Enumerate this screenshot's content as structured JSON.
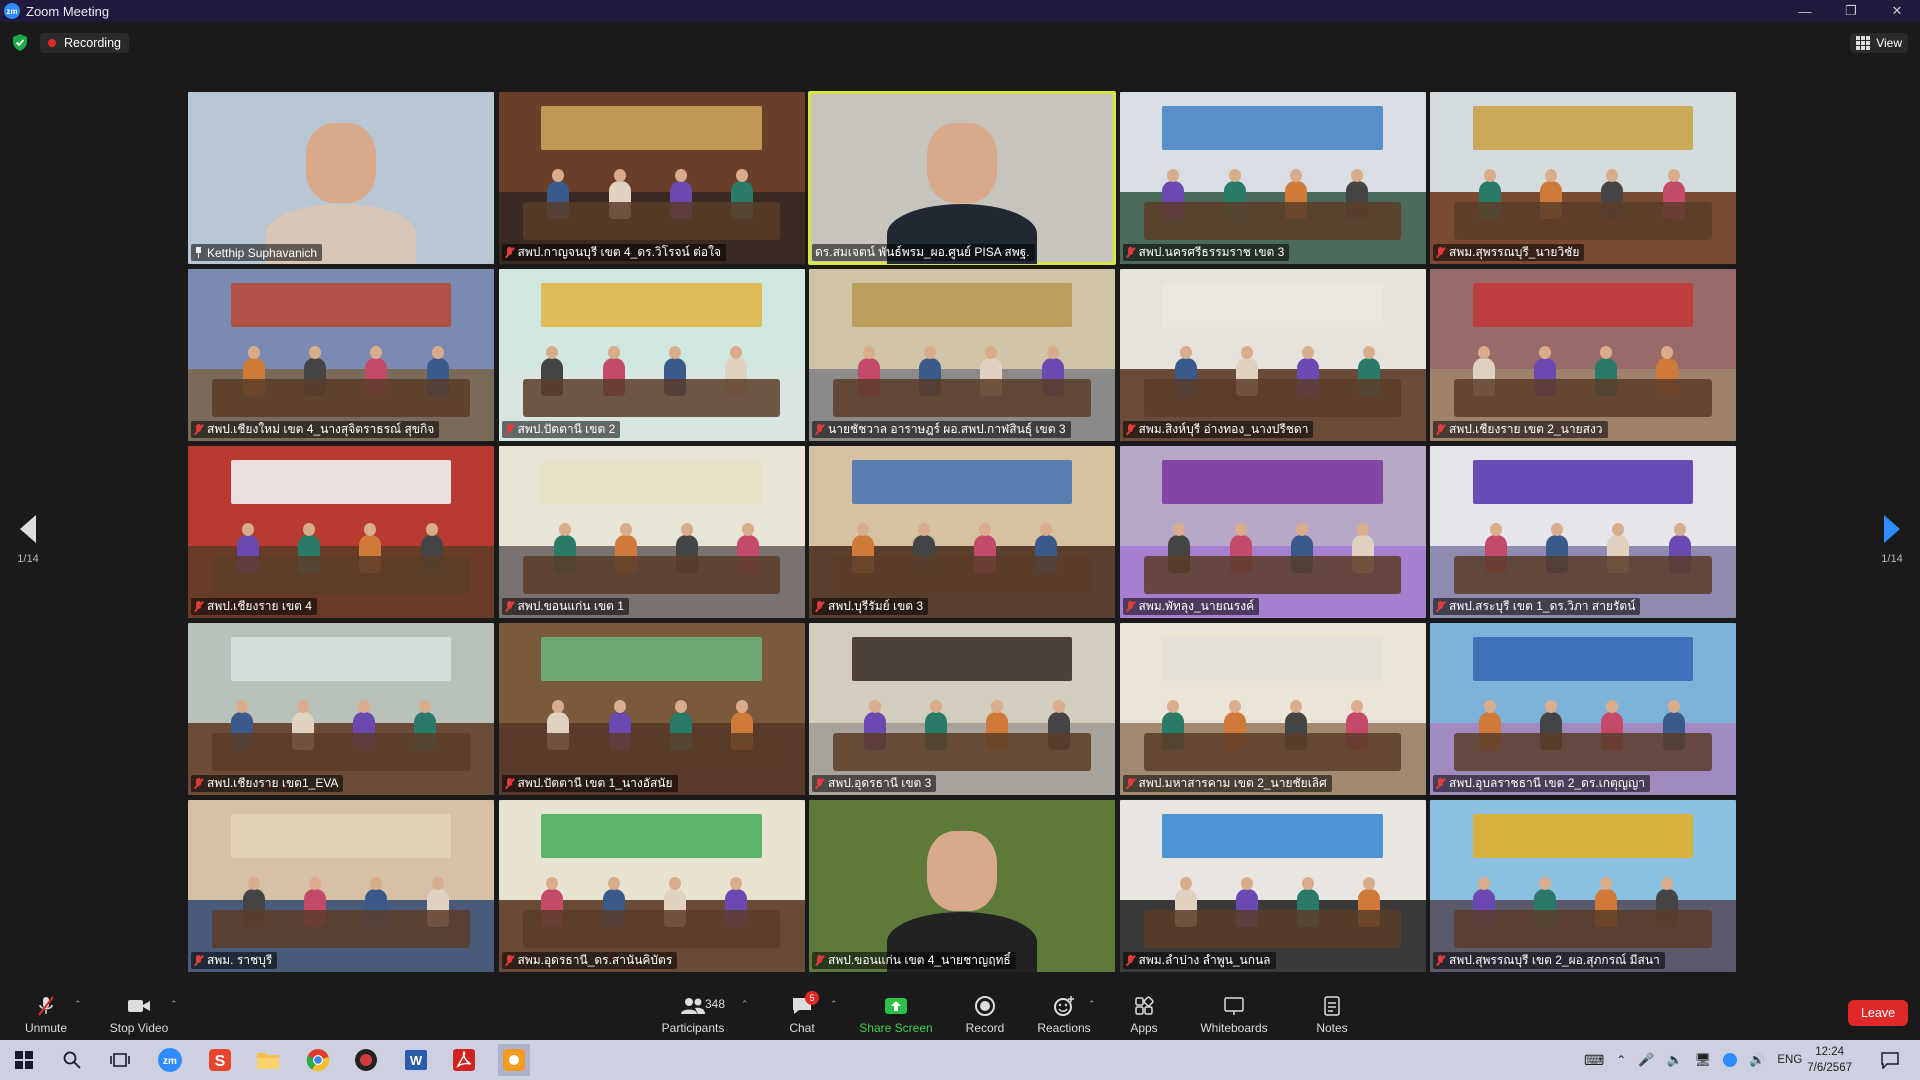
{
  "window": {
    "title": "Zoom Meeting",
    "app_icon": "zm"
  },
  "topbar": {
    "recording_label": "Recording",
    "view_label": "View"
  },
  "pager": {
    "left": "1/14",
    "right": "1/14"
  },
  "tiles": [
    {
      "name": "Ketthip Suphavanich",
      "muted": false,
      "pinned": true,
      "type": "face",
      "bg": "#b9c6d3",
      "body": "#d8c6b6"
    },
    {
      "name": "สพป.กาญจนบุรี เขต 4_ดร.วิโรจน์ ต่อใจ",
      "muted": true,
      "type": "room",
      "bg": "#6b3e2a",
      "floor": "#3a2a22",
      "banner": "#c9a25a"
    },
    {
      "name": "ดร.สมเจตน์ พันธ์พรม_ผอ.ศูนย์ PISA สพฐ.",
      "muted": false,
      "type": "face",
      "bg": "#c7c4bd",
      "body": "#1f2833",
      "active": true
    },
    {
      "name": "สพป.นครศรีธรรมราช เขต 3",
      "muted": true,
      "type": "room",
      "bg": "#d9dee4",
      "floor": "#4c6a5a",
      "banner": "#4a86c5"
    },
    {
      "name": "สพม.สุพรรณบุรี_นายวิชัย",
      "muted": true,
      "type": "room",
      "bg": "#d4dce0",
      "floor": "#7b4a32",
      "banner": "#c8a24a"
    },
    {
      "name": "สพป.เชียงใหม่ เขต 4_นางสุจิตราธรณ์ สุขกิจ",
      "muted": true,
      "type": "room",
      "bg": "#7a8ab2",
      "floor": "#7a6a5a",
      "banner": "#b64a3a"
    },
    {
      "name": "สพป.ปัตตานี เขต 2",
      "muted": true,
      "type": "room",
      "bg": "#cfe7de",
      "floor": "#d7e6e0",
      "banner": "#e0b64a"
    },
    {
      "name": "นายชัชวาล อาราษฎร์ ผอ.สพป.กาฬสินธุ์ เขต 3",
      "muted": true,
      "type": "room",
      "bg": "#cfc4a8",
      "floor": "#8c8a88",
      "banner": "#b89a52"
    },
    {
      "name": "สพม.สิงห์บุรี อ่างทอง_นางปรีชดา",
      "muted": true,
      "type": "room",
      "bg": "#e5e3dc",
      "floor": "#6a4a38",
      "banner": "#e9e7e0"
    },
    {
      "name": "สพป.เชียงราย เขต 2_นายสงว",
      "muted": true,
      "type": "room",
      "bg": "#9a6a6a",
      "floor": "#a0826a",
      "banner": "#c03a3a"
    },
    {
      "name": "สพป.เชียงราย เขต 4",
      "muted": true,
      "type": "room",
      "bg": "#b83a30",
      "floor": "#6a3c28",
      "banner": "#f2f2f2"
    },
    {
      "name": "สพป.ขอนแก่น เขต 1",
      "muted": true,
      "type": "room",
      "bg": "#e8e4d6",
      "floor": "#7a7270",
      "banner": "#e7e2c8"
    },
    {
      "name": "สพป.บุรีรัมย์ เขต 3",
      "muted": true,
      "type": "room",
      "bg": "#d6c2a0",
      "floor": "#5a3e2e",
      "banner": "#4a78b0"
    },
    {
      "name": "สพม.พัทลุง_นายณรงค์",
      "muted": true,
      "type": "room",
      "bg": "#b7a8c7",
      "floor": "#a77fd0",
      "banner": "#7e3aa3"
    },
    {
      "name": "สพป.สระบุรี เขต 1_ดร.วิภา สายรัตน์",
      "muted": true,
      "type": "room",
      "bg": "#e7e5ec",
      "floor": "#8e8ab0",
      "banner": "#5b3bb0"
    },
    {
      "name": "สพป.เชียงราย เขต1_EVA",
      "muted": true,
      "type": "room",
      "bg": "#b8c1ba",
      "floor": "#6c4b38",
      "banner": "#d8e0de"
    },
    {
      "name": "สพป.ปัตตานี เขต 1_นางอัสนัย",
      "muted": true,
      "type": "room",
      "bg": "#7a5a3a",
      "floor": "#5a3a2a",
      "banner": "#6ab07a"
    },
    {
      "name": "สพป.อุดรธานี เขต 3",
      "muted": true,
      "type": "room",
      "bg": "#d2cdbd",
      "floor": "#a8a39a",
      "banner": "#3e3228"
    },
    {
      "name": "สพป.มหาสารคาม เขต 2_นายชัยเลิศ",
      "muted": true,
      "type": "room",
      "bg": "#ebe5d8",
      "floor": "#a28a70",
      "banner": "#e5e0d8"
    },
    {
      "name": "สพป.อุบลราชธานี เขต 2_ดร.เกตุญญา",
      "muted": true,
      "type": "room",
      "bg": "#7fb2d8",
      "floor": "#a08ac0",
      "banner": "#3a6ab8"
    },
    {
      "name": "สพม. ราชบุรี",
      "muted": true,
      "type": "room",
      "bg": "#d6c0a6",
      "floor": "#4a5a7a",
      "banner": "#e6d4ba"
    },
    {
      "name": "สพม.อุดรธานี_ดร.สานันคิบัตร",
      "muted": true,
      "type": "room",
      "bg": "#e8e2d0",
      "floor": "#6a4a36",
      "banner": "#4ab05a"
    },
    {
      "name": "สพป.ขอนแก่น เขต 4_นายชาญฤทธิ์",
      "muted": true,
      "type": "face",
      "bg": "#5e7a3a",
      "body": "#222"
    },
    {
      "name": "สพม.ลำปาง ลำพูน_นกนล",
      "muted": true,
      "type": "room",
      "bg": "#e9e5e0",
      "floor": "#3a3a3a",
      "banner": "#3a8ad0"
    },
    {
      "name": "สพป.สุพรรณบุรี เขต 2_ผอ.สุภกรณ์ มีสนา",
      "muted": true,
      "type": "room",
      "bg": "#8cc0e0",
      "floor": "#5a5a6a",
      "banner": "#e0b030"
    }
  ],
  "toolbar": {
    "unmute": "Unmute",
    "stop_video": "Stop Video",
    "participants": "Participants",
    "participants_count": "348",
    "chat": "Chat",
    "chat_badge": "5",
    "share_screen": "Share Screen",
    "record": "Record",
    "reactions": "Reactions",
    "apps": "Apps",
    "whiteboards": "Whiteboards",
    "notes": "Notes",
    "leave": "Leave"
  },
  "taskbar": {
    "lang": "ENG",
    "time": "12:24",
    "date": "7/6/2567"
  }
}
